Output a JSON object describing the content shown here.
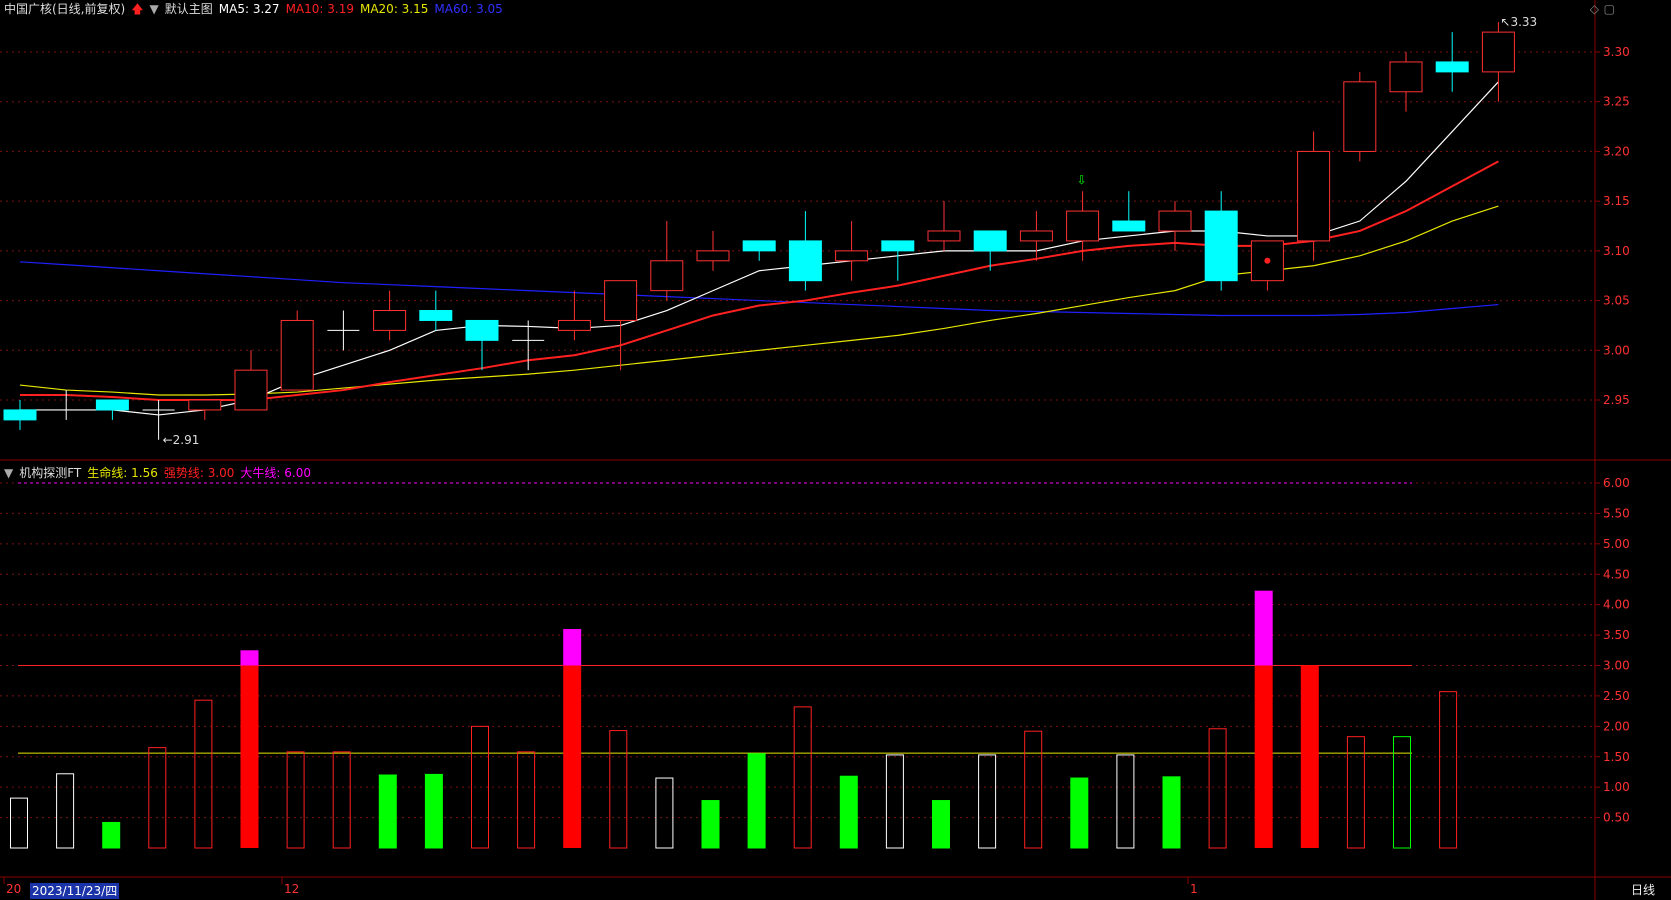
{
  "header": {
    "stock_title": "中国广核(日线,前复权)",
    "up_arrow_icon": "red-up-arrow",
    "main_chart_label": "默认主图",
    "ma5": "MA5: 3.27",
    "ma10": "MA10: 3.19",
    "ma20": "MA20: 3.15",
    "ma60": "MA60: 3.05"
  },
  "indicator": {
    "name": "机构探测FT",
    "life_line": "生命线: 1.56",
    "strong_line": "强势线: 3.00",
    "bull_line": "大牛线: 6.00"
  },
  "annotations": {
    "low_label": "2.91",
    "high_label": "3.33"
  },
  "axis": {
    "price_ticks": [
      "3.30",
      "3.25",
      "3.20",
      "3.15",
      "3.10",
      "3.05",
      "3.00",
      "2.95"
    ],
    "ind_ticks": [
      "6.00",
      "5.50",
      "5.00",
      "4.50",
      "4.00",
      "3.50",
      "3.00",
      "2.50",
      "2.00",
      "1.50",
      "1.00",
      "0.50"
    ],
    "month_labels": [
      "20",
      "12",
      "1"
    ]
  },
  "footer": {
    "date": "2023/11/23/四",
    "period": "日线"
  },
  "colors": {
    "up": "#ff3232",
    "down": "#00ffff",
    "ma5": "#ffffff",
    "ma10": "#ff2020",
    "ma20": "#e6e600",
    "ma60": "#2020ff",
    "ind_green": "#00ff00",
    "ind_magenta": "#ff00ff"
  },
  "chart_data": [
    {
      "type": "candlestick",
      "title": "中国广核(日线,前复权)",
      "candles": [
        {
          "o": 2.94,
          "h": 2.95,
          "l": 2.92,
          "c": 2.93
        },
        {
          "o": 2.94,
          "h": 2.96,
          "l": 2.93,
          "c": 2.94
        },
        {
          "o": 2.95,
          "h": 2.95,
          "l": 2.93,
          "c": 2.94
        },
        {
          "o": 2.94,
          "h": 2.95,
          "l": 2.91,
          "c": 2.94
        },
        {
          "o": 2.94,
          "h": 2.95,
          "l": 2.93,
          "c": 2.95
        },
        {
          "o": 2.94,
          "h": 3.0,
          "l": 2.94,
          "c": 2.98
        },
        {
          "o": 2.96,
          "h": 3.04,
          "l": 2.96,
          "c": 3.03
        },
        {
          "o": 3.02,
          "h": 3.04,
          "l": 3.0,
          "c": 3.02
        },
        {
          "o": 3.02,
          "h": 3.06,
          "l": 3.01,
          "c": 3.04
        },
        {
          "o": 3.04,
          "h": 3.06,
          "l": 3.02,
          "c": 3.03
        },
        {
          "o": 3.03,
          "h": 3.03,
          "l": 2.98,
          "c": 3.01
        },
        {
          "o": 3.01,
          "h": 3.03,
          "l": 2.98,
          "c": 3.01
        },
        {
          "o": 3.02,
          "h": 3.06,
          "l": 3.01,
          "c": 3.03
        },
        {
          "o": 3.03,
          "h": 3.07,
          "l": 2.98,
          "c": 3.07
        },
        {
          "o": 3.06,
          "h": 3.13,
          "l": 3.05,
          "c": 3.09
        },
        {
          "o": 3.09,
          "h": 3.12,
          "l": 3.08,
          "c": 3.1
        },
        {
          "o": 3.11,
          "h": 3.11,
          "l": 3.09,
          "c": 3.1
        },
        {
          "o": 3.11,
          "h": 3.14,
          "l": 3.06,
          "c": 3.07
        },
        {
          "o": 3.09,
          "h": 3.13,
          "l": 3.07,
          "c": 3.1
        },
        {
          "o": 3.11,
          "h": 3.11,
          "l": 3.07,
          "c": 3.1
        },
        {
          "o": 3.11,
          "h": 3.15,
          "l": 3.1,
          "c": 3.12
        },
        {
          "o": 3.12,
          "h": 3.12,
          "l": 3.08,
          "c": 3.1
        },
        {
          "o": 3.11,
          "h": 3.14,
          "l": 3.09,
          "c": 3.12
        },
        {
          "o": 3.11,
          "h": 3.16,
          "l": 3.09,
          "c": 3.14
        },
        {
          "o": 3.13,
          "h": 3.16,
          "l": 3.12,
          "c": 3.12
        },
        {
          "o": 3.12,
          "h": 3.15,
          "l": 3.1,
          "c": 3.14
        },
        {
          "o": 3.14,
          "h": 3.16,
          "l": 3.06,
          "c": 3.07
        },
        {
          "o": 3.07,
          "h": 3.11,
          "l": 3.06,
          "c": 3.11
        },
        {
          "o": 3.11,
          "h": 3.22,
          "l": 3.09,
          "c": 3.2
        },
        {
          "o": 3.2,
          "h": 3.28,
          "l": 3.19,
          "c": 3.27
        },
        {
          "o": 3.26,
          "h": 3.3,
          "l": 3.24,
          "c": 3.29
        },
        {
          "o": 3.29,
          "h": 3.32,
          "l": 3.26,
          "c": 3.28
        },
        {
          "o": 3.28,
          "h": 3.33,
          "l": 3.25,
          "c": 3.32
        }
      ],
      "ma5": [
        2.94,
        2.94,
        2.94,
        2.935,
        2.94,
        2.95,
        2.97,
        2.985,
        3.0,
        3.02,
        3.025,
        3.024,
        3.022,
        3.025,
        3.04,
        3.06,
        3.08,
        3.085,
        3.09,
        3.095,
        3.1,
        3.1,
        3.1,
        3.11,
        3.115,
        3.12,
        3.12,
        3.115,
        3.115,
        3.13,
        3.17,
        3.22,
        3.27
      ],
      "ma10": [
        2.955,
        2.955,
        2.953,
        2.95,
        2.95,
        2.95,
        2.955,
        2.96,
        2.968,
        2.975,
        2.982,
        2.99,
        2.995,
        3.005,
        3.02,
        3.035,
        3.045,
        3.05,
        3.058,
        3.065,
        3.075,
        3.085,
        3.092,
        3.1,
        3.105,
        3.108,
        3.105,
        3.105,
        3.11,
        3.12,
        3.14,
        3.165,
        3.19
      ],
      "ma20": [
        2.965,
        2.96,
        2.958,
        2.955,
        2.955,
        2.956,
        2.958,
        2.962,
        2.966,
        2.97,
        2.973,
        2.976,
        2.98,
        2.985,
        2.99,
        2.995,
        3.0,
        3.005,
        3.01,
        3.015,
        3.022,
        3.03,
        3.037,
        3.045,
        3.053,
        3.06,
        3.075,
        3.08,
        3.085,
        3.095,
        3.11,
        3.13,
        3.145
      ],
      "ma60": [
        3.089,
        3.086,
        3.083,
        3.08,
        3.077,
        3.074,
        3.071,
        3.068,
        3.066,
        3.064,
        3.062,
        3.06,
        3.058,
        3.056,
        3.054,
        3.052,
        3.05,
        3.048,
        3.046,
        3.044,
        3.042,
        3.04,
        3.039,
        3.038,
        3.037,
        3.036,
        3.035,
        3.035,
        3.035,
        3.036,
        3.038,
        3.042,
        3.046
      ]
    },
    {
      "type": "bar",
      "title": "机构探测FT",
      "values": [
        0.82,
        1.22,
        0.42,
        1.65,
        2.43,
        3.25,
        1.58,
        1.58,
        1.2,
        1.21,
        2.0,
        1.58,
        3.6,
        1.93,
        1.15,
        0.78,
        1.55,
        2.32,
        1.18,
        1.53,
        0.78,
        1.53,
        1.92,
        1.15,
        1.53,
        1.17,
        1.96,
        4.23,
        3.0,
        1.83,
        1.83,
        2.57
      ],
      "styles": [
        "white",
        "white",
        "green",
        "red-hollow",
        "red-hollow",
        "red-solid",
        "red-hollow",
        "red-hollow",
        "green",
        "green",
        "red-hollow",
        "red-hollow",
        "red-solid",
        "red-hollow",
        "white",
        "green",
        "green",
        "red-hollow",
        "green",
        "white",
        "green",
        "white",
        "red-hollow",
        "green",
        "white",
        "green",
        "red-hollow",
        "red-solid",
        "red-solid",
        "red-hollow",
        "green-hollow",
        "red-hollow"
      ],
      "life_line": 1.56,
      "strong_line": 3.0,
      "bull_line": 6.0,
      "ylim": [
        0,
        6.3
      ]
    }
  ]
}
